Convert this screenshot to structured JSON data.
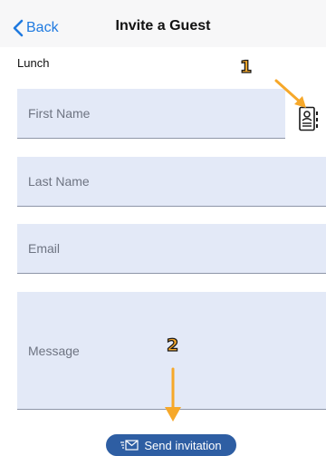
{
  "navbar": {
    "back_label": "Back",
    "title": "Invite a Guest"
  },
  "subtitle": "Lunch",
  "form": {
    "first_name_placeholder": "First Name",
    "last_name_placeholder": "Last Name",
    "email_placeholder": "Email",
    "message_placeholder": "Message"
  },
  "annotations": {
    "badge_1": "1",
    "badge_2": "2"
  },
  "send_button": {
    "label": "Send invitation",
    "icon": "envelope-icon"
  },
  "icons": {
    "back": "chevron-left-icon",
    "contacts": "contact-book-icon"
  },
  "colors": {
    "accent": "#1f7ae0",
    "field_bg": "#e3e9f7",
    "button_bg": "#2e5ea3",
    "annotation": "#f6a82a"
  }
}
